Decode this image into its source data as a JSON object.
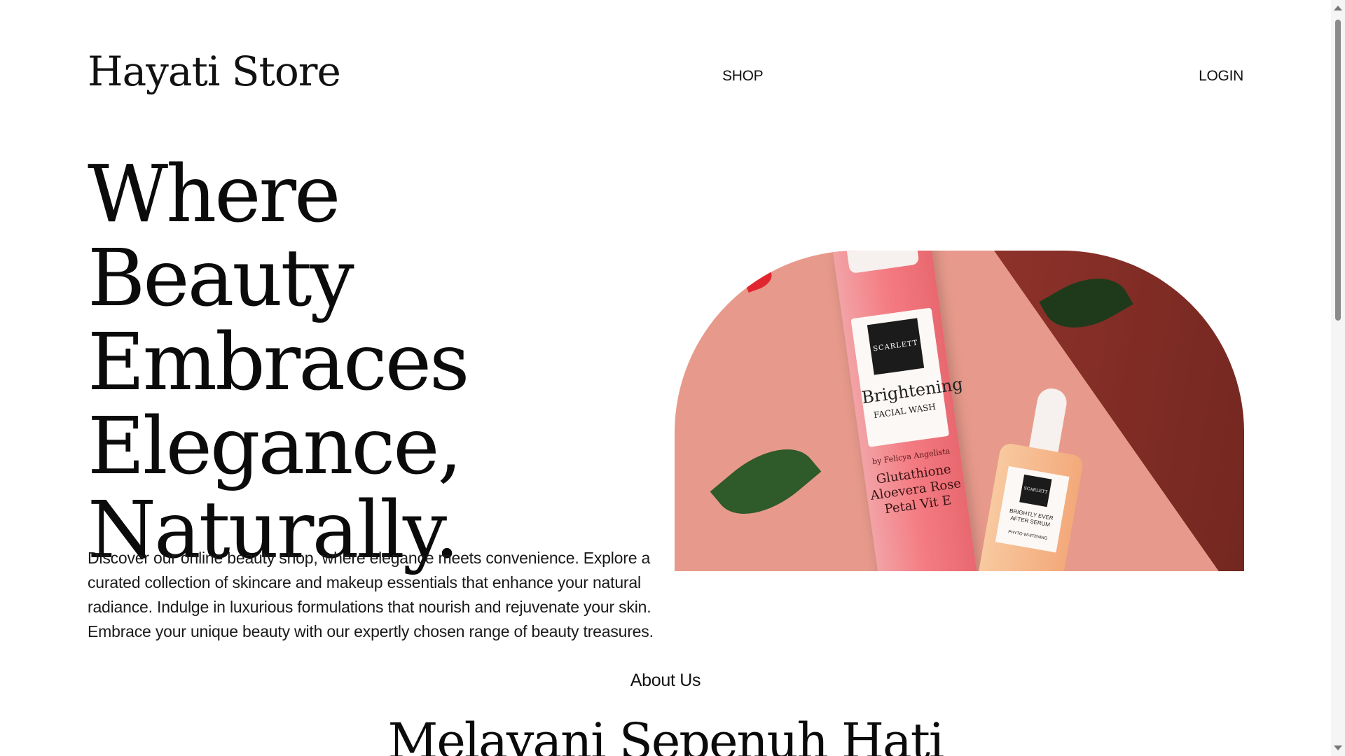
{
  "header": {
    "brand": "Hayati Store",
    "nav_shop": "SHOP",
    "nav_login": "LOGIN"
  },
  "hero": {
    "title": "Where Beauty Embraces Elegance, Naturally.",
    "description": "Discover our online beauty shop, where elegance meets convenience. Explore a curated collection of skincare and makeup essentials that enhance your natural radiance. Indulge in luxurious formulations that nourish and rejuvenate your skin. Embrace your unique beauty with our expertly chosen range of beauty treasures.",
    "image": {
      "bottle_brand": "SCARLETT",
      "bottle_name": "Brightening",
      "bottle_type": "FACIAL WASH",
      "bottle_by": "by Felicya Angelista",
      "bottle_ingredients": "Glutathione Aloevera Rose Petal Vit E",
      "serum_brand": "SCARLETT",
      "serum_name": "BRIGHTLY EVER AFTER SERUM",
      "serum_sub": "PHYTO WHITENING"
    }
  },
  "about": {
    "label": "About Us",
    "title": "Melayani Sepenuh Hati"
  },
  "colors": {
    "text": "#111111",
    "background": "#ffffff",
    "image_pink": "#e79a8b",
    "shadow": "#6b1d17",
    "leaf": "#2f5a2a"
  }
}
